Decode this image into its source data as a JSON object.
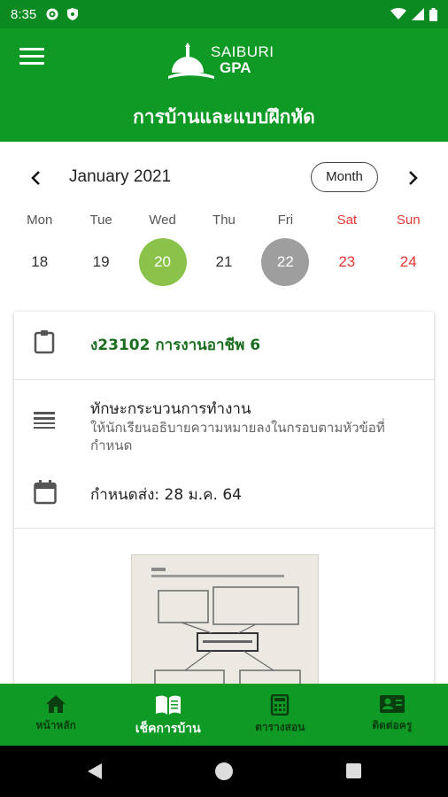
{
  "status_bar": {
    "time": "8:35",
    "icons": [
      "gear-icon",
      "shield-icon",
      "wifi-icon",
      "signal-icon",
      "battery-icon"
    ]
  },
  "app_bar": {
    "logo_line1": "SAIBURI",
    "logo_line2": "GPA",
    "title": "การบ้านและแบบฝึกหัด"
  },
  "calendar": {
    "month_label": "January 2021",
    "mode_label": "Month",
    "weekdays": [
      "Mon",
      "Tue",
      "Wed",
      "Thu",
      "Fri",
      "Sat",
      "Sun"
    ],
    "dates": [
      "18",
      "19",
      "20",
      "21",
      "22",
      "23",
      "24"
    ],
    "selected_date": "20",
    "today_date": "22",
    "weekend_color": "#e53935",
    "selected_color": "#8bc34a",
    "today_color": "#9e9e9e"
  },
  "homework": {
    "subject": "ง23102 การงานอาชีพ 6",
    "task_title": "ทักษะกระบวนการทำงาน",
    "task_description": "ให้นักเรียนอธิบายความหมายลงในกรอบตามหัวข้อที่กำหนด",
    "due_label": "กำหนดส่ง: 28 ม.ค. 64"
  },
  "bottom_nav": {
    "items": [
      {
        "label": "หน้าหลัก",
        "icon": "home-icon",
        "active": false
      },
      {
        "label": "เช็คการบ้าน",
        "icon": "book-icon",
        "active": true
      },
      {
        "label": "ตารางสอน",
        "icon": "calculator-icon",
        "active": false
      },
      {
        "label": "ติดต่อครู",
        "icon": "contact-card-icon",
        "active": false
      }
    ]
  },
  "colors": {
    "brand_green": "#0e9a24",
    "status_green": "#0b8a21",
    "subject_green": "#1b6e20"
  }
}
